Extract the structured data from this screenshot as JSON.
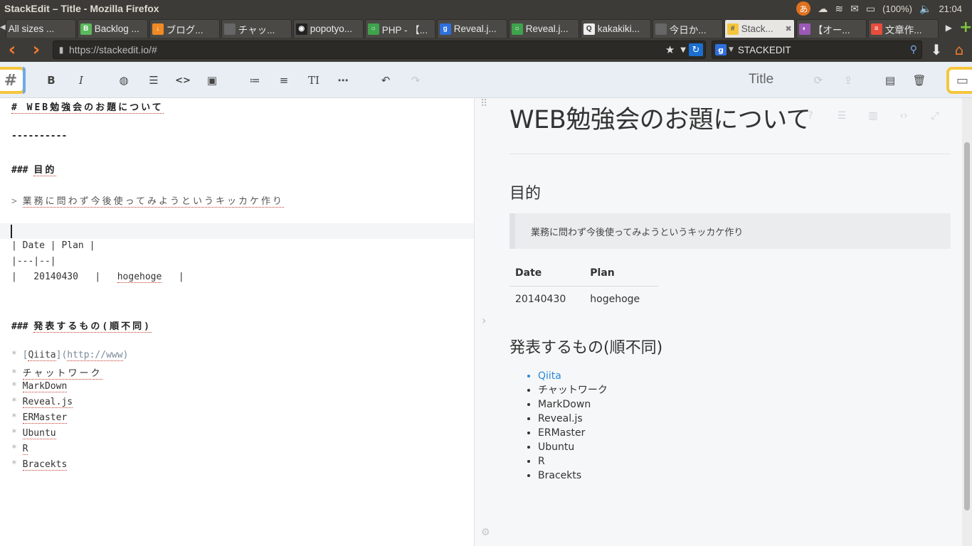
{
  "window": {
    "title": "StackEdit – Title - Mozilla Firefox"
  },
  "tray": {
    "ime": "あ",
    "battery": "(100%)",
    "clock": "21:04"
  },
  "tabs": [
    {
      "label": "All sizes ...",
      "color": "#555555",
      "glyph": ""
    },
    {
      "label": "Backlog ...",
      "color": "#5cb85c",
      "glyph": "B"
    },
    {
      "label": "ブログ...",
      "color": "#f08a24",
      "glyph": "↓"
    },
    {
      "label": "チャッ...",
      "color": "#666666",
      "glyph": ""
    },
    {
      "label": "popotyo...",
      "color": "#222222",
      "glyph": "◉"
    },
    {
      "label": "PHP - 【...",
      "color": "#3fa34d",
      "glyph": "○"
    },
    {
      "label": "Reveal.j...",
      "color": "#2f6fde",
      "glyph": "g"
    },
    {
      "label": "Reveal.j...",
      "color": "#3fa34d",
      "glyph": "○"
    },
    {
      "label": "kakakiki...",
      "color": "#eeeeee",
      "glyph": "Q"
    },
    {
      "label": "今日か...",
      "color": "#666666",
      "glyph": ""
    },
    {
      "label": "Stack...",
      "color": "#f5c63c",
      "glyph": "#"
    },
    {
      "label": "【オー...",
      "color": "#9b59b6",
      "glyph": "◐"
    },
    {
      "label": "文章作...",
      "color": "#e74c3c",
      "glyph": "≡"
    }
  ],
  "nav": {
    "url": "https://stackedit.io/#",
    "search_engine": "STACKEDIT"
  },
  "toolbar": {
    "menu_icon": "#",
    "doc_title": "Title",
    "buttons": [
      "B",
      "I",
      "🌐",
      "☰",
      "<>",
      "▣",
      "≔",
      "•≡",
      "TI",
      "…",
      "↶",
      "↷"
    ]
  },
  "editor": {
    "lines": {
      "h1": "# WEB勉強会のお題について",
      "rule": "----------",
      "h3a_prefix": "### ",
      "h3a": "目的",
      "bq_mark": "> ",
      "bq_text": "業務に問わず今後使ってみようというキッカケ作り",
      "table_head": "| Date | Plan |",
      "table_sep": "|---|--|",
      "table_row_a": "|   20140430   |   ",
      "table_row_b": "hogehoge",
      "table_row_c": "   |",
      "h3b_prefix": "### ",
      "h3b": "発表するもの(順不同)",
      "list_link_text": "Qiita",
      "list_link_url": "http://www"
    },
    "list": [
      "チャットワーク",
      "MarkDown",
      "Reveal.js",
      "ERMaster",
      "Ubuntu",
      "R",
      "Bracekts"
    ]
  },
  "preview": {
    "h1": "WEB勉強会のお題について",
    "h3a": "目的",
    "blockquote": "業務に問わず今後使ってみようというキッカケ作り",
    "table": {
      "headers": [
        "Date",
        "Plan"
      ],
      "rows": [
        [
          "20140430",
          "hogehoge"
        ]
      ]
    },
    "h3b": "発表するもの(順不同)",
    "list_link": "Qiita",
    "list": [
      "チャットワーク",
      "MarkDown",
      "Reveal.js",
      "ERMaster",
      "Ubuntu",
      "R",
      "Bracekts"
    ]
  }
}
